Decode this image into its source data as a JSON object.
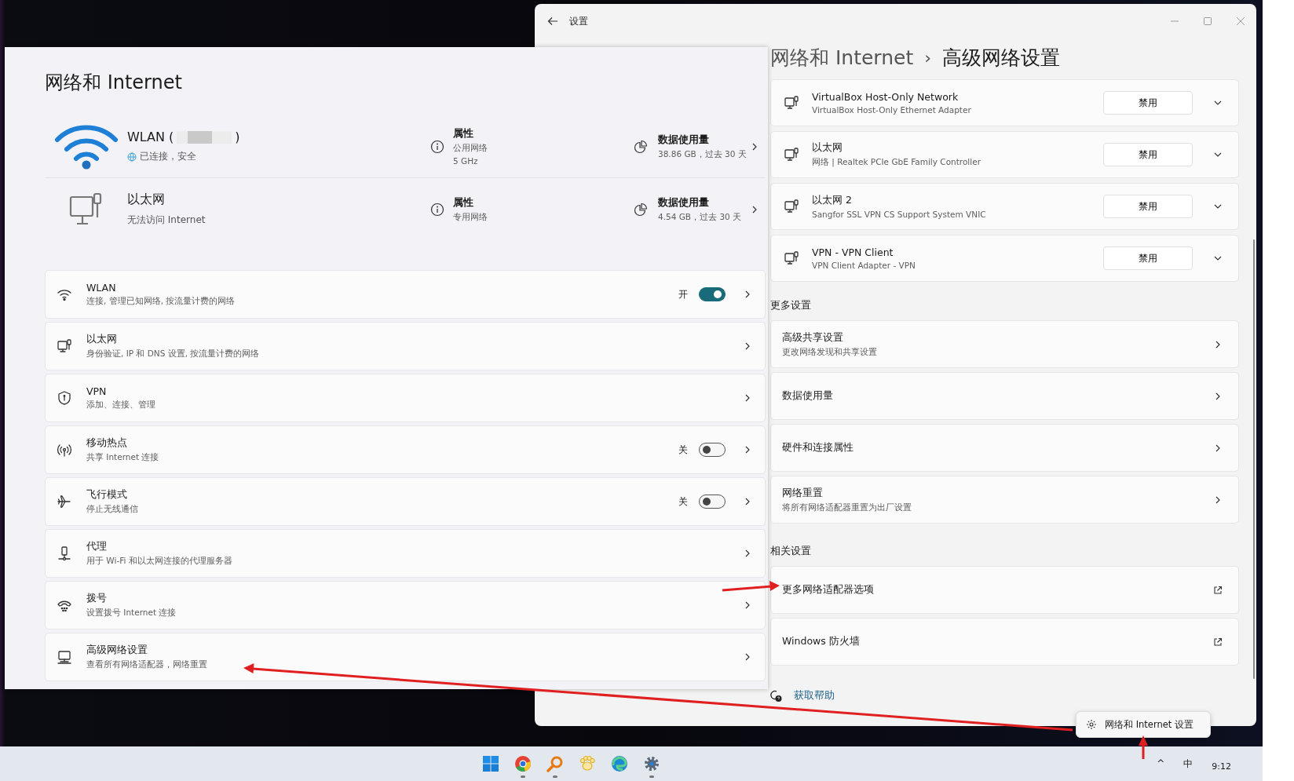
{
  "right_window": {
    "title": "设置",
    "breadcrumb": [
      "网络和 Internet",
      "高级网络设置"
    ],
    "breadcrumb_separator": "›",
    "adapters": [
      {
        "name": "VirtualBox Host-Only Network",
        "description": "VirtualBox Host-Only Ethernet Adapter",
        "button": "禁用"
      },
      {
        "name": "以太网",
        "description": "网络 | Realtek PCIe GbE Family Controller",
        "button": "禁用"
      },
      {
        "name": "以太网 2",
        "description": "Sangfor SSL VPN CS Support System VNIC",
        "button": "禁用"
      },
      {
        "name": "VPN - VPN Client",
        "description": "VPN Client Adapter - VPN",
        "button": "禁用"
      }
    ],
    "sections": [
      {
        "title": "更多设置",
        "items": [
          {
            "kind": "nav",
            "title": "高级共享设置",
            "subtitle": "更改网络发现和共享设置"
          },
          {
            "kind": "nav",
            "title": "数据使用量"
          },
          {
            "kind": "nav",
            "title": "硬件和连接属性"
          },
          {
            "kind": "nav",
            "title": "网络重置",
            "subtitle": "将所有网络适配器重置为出厂设置"
          }
        ]
      },
      {
        "title": "相关设置",
        "items": [
          {
            "kind": "external",
            "title": "更多网络适配器选项"
          },
          {
            "kind": "external",
            "title": "Windows 防火墙"
          }
        ]
      }
    ],
    "help_link": "获取帮助"
  },
  "left_panel": {
    "title": "网络和 Internet",
    "connections": [
      {
        "kind": "wifi",
        "name": "WLAN (",
        "redacted": true,
        "name_end": ")",
        "connected": true,
        "status": "已连接，安全",
        "properties": {
          "title": "属性",
          "lines": [
            "公用网络",
            "5 GHz"
          ]
        },
        "data_usage": {
          "title": "数据使用量",
          "detail": "38.86 GB，过去 30 天"
        }
      },
      {
        "kind": "ethernet",
        "name": "以太网",
        "connected": false,
        "status": "无法访问 Internet",
        "properties": {
          "title": "属性",
          "lines": [
            "专用网络"
          ]
        },
        "data_usage": {
          "title": "数据使用量",
          "detail": "4.54 GB，过去 30 天"
        }
      }
    ],
    "items": [
      {
        "title": "WLAN",
        "subtitle": "连接, 管理已知网络, 按流量计费的网络",
        "toggle": {
          "label": "开",
          "on": true
        }
      },
      {
        "title": "以太网",
        "subtitle": "身份验证, IP 和 DNS 设置, 按流量计费的网络"
      },
      {
        "title": "VPN",
        "subtitle": "添加、连接、管理"
      },
      {
        "title": "移动热点",
        "subtitle": "共享 Internet 连接",
        "toggle": {
          "label": "关",
          "on": false
        }
      },
      {
        "title": "飞行模式",
        "subtitle": "停止无线通信",
        "toggle": {
          "label": "关",
          "on": false
        }
      },
      {
        "title": "代理",
        "subtitle": "用于 Wi-Fi 和以太网连接的代理服务器"
      },
      {
        "title": "拨号",
        "subtitle": "设置拨号 Internet 连接"
      },
      {
        "title": "高级网络设置",
        "subtitle": "查看所有网络适配器，网络重置"
      }
    ]
  },
  "flyout_button": "网络和 Internet 设置",
  "taskbar": {
    "apps": [
      {
        "running": false
      },
      {
        "running": true
      },
      {
        "running": true
      },
      {
        "running": false
      },
      {
        "running": false
      },
      {
        "running": true
      }
    ],
    "tray": [
      "^",
      "中"
    ],
    "clock": "9:12"
  }
}
